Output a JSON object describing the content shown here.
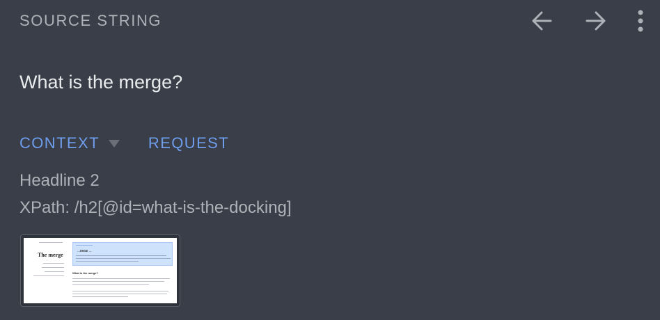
{
  "header": {
    "title": "SOURCE STRING",
    "icons": {
      "back": "arrow-left-icon",
      "forward": "arrow-right-icon",
      "menu": "more-vertical-icon"
    }
  },
  "source": {
    "text": "What is the merge?"
  },
  "tabs": [
    {
      "label": "CONTEXT",
      "icon": "caret-down-icon"
    },
    {
      "label": "REQUEST"
    }
  ],
  "context": {
    "type": "Headline 2",
    "xpath": "XPath: /h2[@id=what-is-the-docking]"
  },
  "screenshot": {
    "page_title": "The merge",
    "banner_heading": "…ERGE …",
    "section_heading": "What is the merge?"
  },
  "colors": {
    "background": "#393e48",
    "muted_text": "#aeb2b8",
    "primary_text": "#e9eaec",
    "accent": "#6f9ded"
  }
}
